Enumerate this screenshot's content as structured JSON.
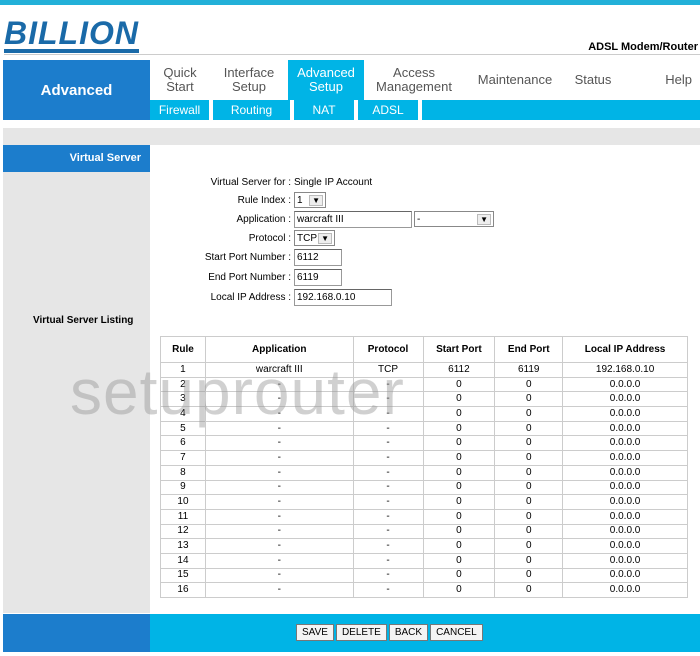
{
  "brand": {
    "logo": "BILLION",
    "product": "ADSL Modem/Router"
  },
  "section": "Advanced",
  "nav": [
    {
      "label": "Quick Start"
    },
    {
      "label": "Interface Setup"
    },
    {
      "label": "Advanced Setup",
      "active": true
    },
    {
      "label": "Access Management"
    },
    {
      "label": "Maintenance"
    },
    {
      "label": "Status"
    },
    {
      "label": "Help"
    }
  ],
  "subnav": [
    {
      "label": "Firewall"
    },
    {
      "label": "Routing"
    },
    {
      "label": "NAT"
    },
    {
      "label": "ADSL"
    }
  ],
  "sidebar": {
    "title": "Virtual Server"
  },
  "form": {
    "vs_for_label": "Virtual Server for :",
    "vs_for_value": "Single IP Account",
    "rule_index_label": "Rule Index :",
    "rule_index_value": "1",
    "application_label": "Application :",
    "application_value": "warcraft III",
    "application_select": "-",
    "protocol_label": "Protocol :",
    "protocol_value": "TCP",
    "start_port_label": "Start Port Number :",
    "start_port_value": "6112",
    "end_port_label": "End Port Number :",
    "end_port_value": "6119",
    "local_ip_label": "Local IP Address :",
    "local_ip_value": "192.168.0.10"
  },
  "listing": {
    "title": "Virtual Server Listing",
    "headers": [
      "Rule",
      "Application",
      "Protocol",
      "Start Port",
      "End Port",
      "Local IP Address"
    ],
    "rows": [
      [
        "1",
        "warcraft III",
        "TCP",
        "6112",
        "6119",
        "192.168.0.10"
      ],
      [
        "2",
        "-",
        "-",
        "0",
        "0",
        "0.0.0.0"
      ],
      [
        "3",
        "-",
        "-",
        "0",
        "0",
        "0.0.0.0"
      ],
      [
        "4",
        "-",
        "-",
        "0",
        "0",
        "0.0.0.0"
      ],
      [
        "5",
        "-",
        "-",
        "0",
        "0",
        "0.0.0.0"
      ],
      [
        "6",
        "-",
        "-",
        "0",
        "0",
        "0.0.0.0"
      ],
      [
        "7",
        "-",
        "-",
        "0",
        "0",
        "0.0.0.0"
      ],
      [
        "8",
        "-",
        "-",
        "0",
        "0",
        "0.0.0.0"
      ],
      [
        "9",
        "-",
        "-",
        "0",
        "0",
        "0.0.0.0"
      ],
      [
        "10",
        "-",
        "-",
        "0",
        "0",
        "0.0.0.0"
      ],
      [
        "11",
        "-",
        "-",
        "0",
        "0",
        "0.0.0.0"
      ],
      [
        "12",
        "-",
        "-",
        "0",
        "0",
        "0.0.0.0"
      ],
      [
        "13",
        "-",
        "-",
        "0",
        "0",
        "0.0.0.0"
      ],
      [
        "14",
        "-",
        "-",
        "0",
        "0",
        "0.0.0.0"
      ],
      [
        "15",
        "-",
        "-",
        "0",
        "0",
        "0.0.0.0"
      ],
      [
        "16",
        "-",
        "-",
        "0",
        "0",
        "0.0.0.0"
      ]
    ]
  },
  "buttons": {
    "save": "SAVE",
    "delete": "DELETE",
    "back": "BACK",
    "cancel": "CANCEL"
  },
  "watermark": "setuprouter",
  "colors": {
    "cyan": "#00b4e6",
    "blue": "#1c7dcc"
  }
}
